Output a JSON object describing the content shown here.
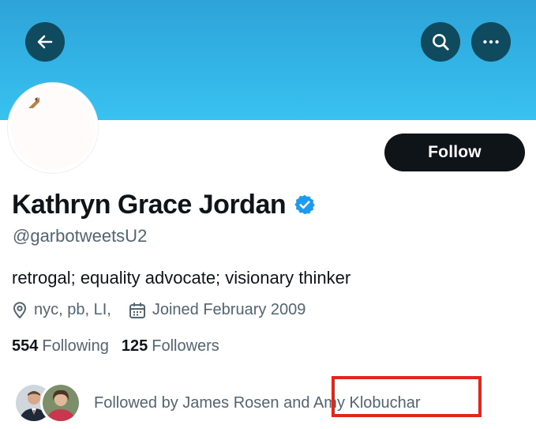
{
  "header": {
    "back_icon": "arrow-left-icon",
    "search_icon": "search-icon",
    "more_icon": "more-horizontal-icon",
    "banner_color": "#33b4e6"
  },
  "profile": {
    "display_name": "Kathryn Grace Jordan",
    "verified": true,
    "verified_color": "#1d9bf0",
    "handle": "@garbotweetsU2",
    "bio": "retrogal; equality advocate; visionary thinker",
    "location": "nyc, pb, LI,",
    "location_icon": "location-pin-icon",
    "joined": "Joined February 2009",
    "joined_icon": "calendar-icon"
  },
  "actions": {
    "follow_label": "Follow"
  },
  "stats": {
    "following_count": "554",
    "following_label": "Following",
    "followers_count": "125",
    "followers_label": "Followers"
  },
  "followed_by": {
    "text_prefix": "Followed by James Rosen and ",
    "text_highlight": "Amy Klobuchar",
    "annotation_color": "#e2261b"
  }
}
